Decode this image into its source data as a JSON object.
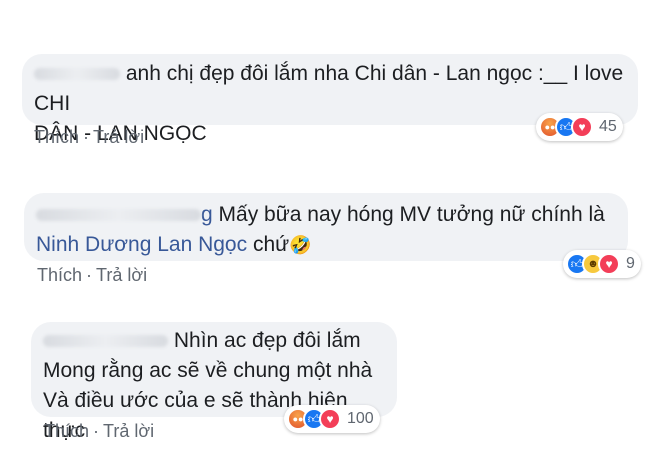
{
  "comments": [
    {
      "text": "anh chị đẹp đôi lắm nha Chi dân - Lan ngọc :__ I love CHI DÂN - LAN NGỌC",
      "line1": "anh chị đẹp đôi lắm nha Chi dân - Lan ngọc :__ I love CHI",
      "line2": "DÂN - LAN NGỌC",
      "like_label": "Thích",
      "reply_label": "Trả lời",
      "reactions": [
        "angry",
        "like",
        "love"
      ],
      "reaction_count": "45"
    },
    {
      "author_tail": "g",
      "line1": "Mấy bữa nay hóng MV tưởng nữ chính là",
      "mention": "Ninh Dương Lan Ngọc",
      "line2_tail": " chứ",
      "emoji": "🤣",
      "like_label": "Thích",
      "reply_label": "Trả lời",
      "reactions": [
        "like",
        "haha",
        "love"
      ],
      "reaction_count": "9"
    },
    {
      "line1": "Nhìn ac đẹp đôi lắm",
      "line2": "Mong rằng ac sẽ về chung một nhà",
      "line3": "Và điều ước của e sẽ thành hiện thực",
      "like_label": "Thích",
      "reply_label": "Trả lời",
      "reactions": [
        "angry",
        "like",
        "love"
      ],
      "reaction_count": "100"
    }
  ],
  "separator": "·",
  "colors": {
    "bubble": "#f0f2f5",
    "link": "#385898",
    "meta": "#606770",
    "like": "#1877f2",
    "love": "#f33e58",
    "angry": "#e0522c"
  }
}
